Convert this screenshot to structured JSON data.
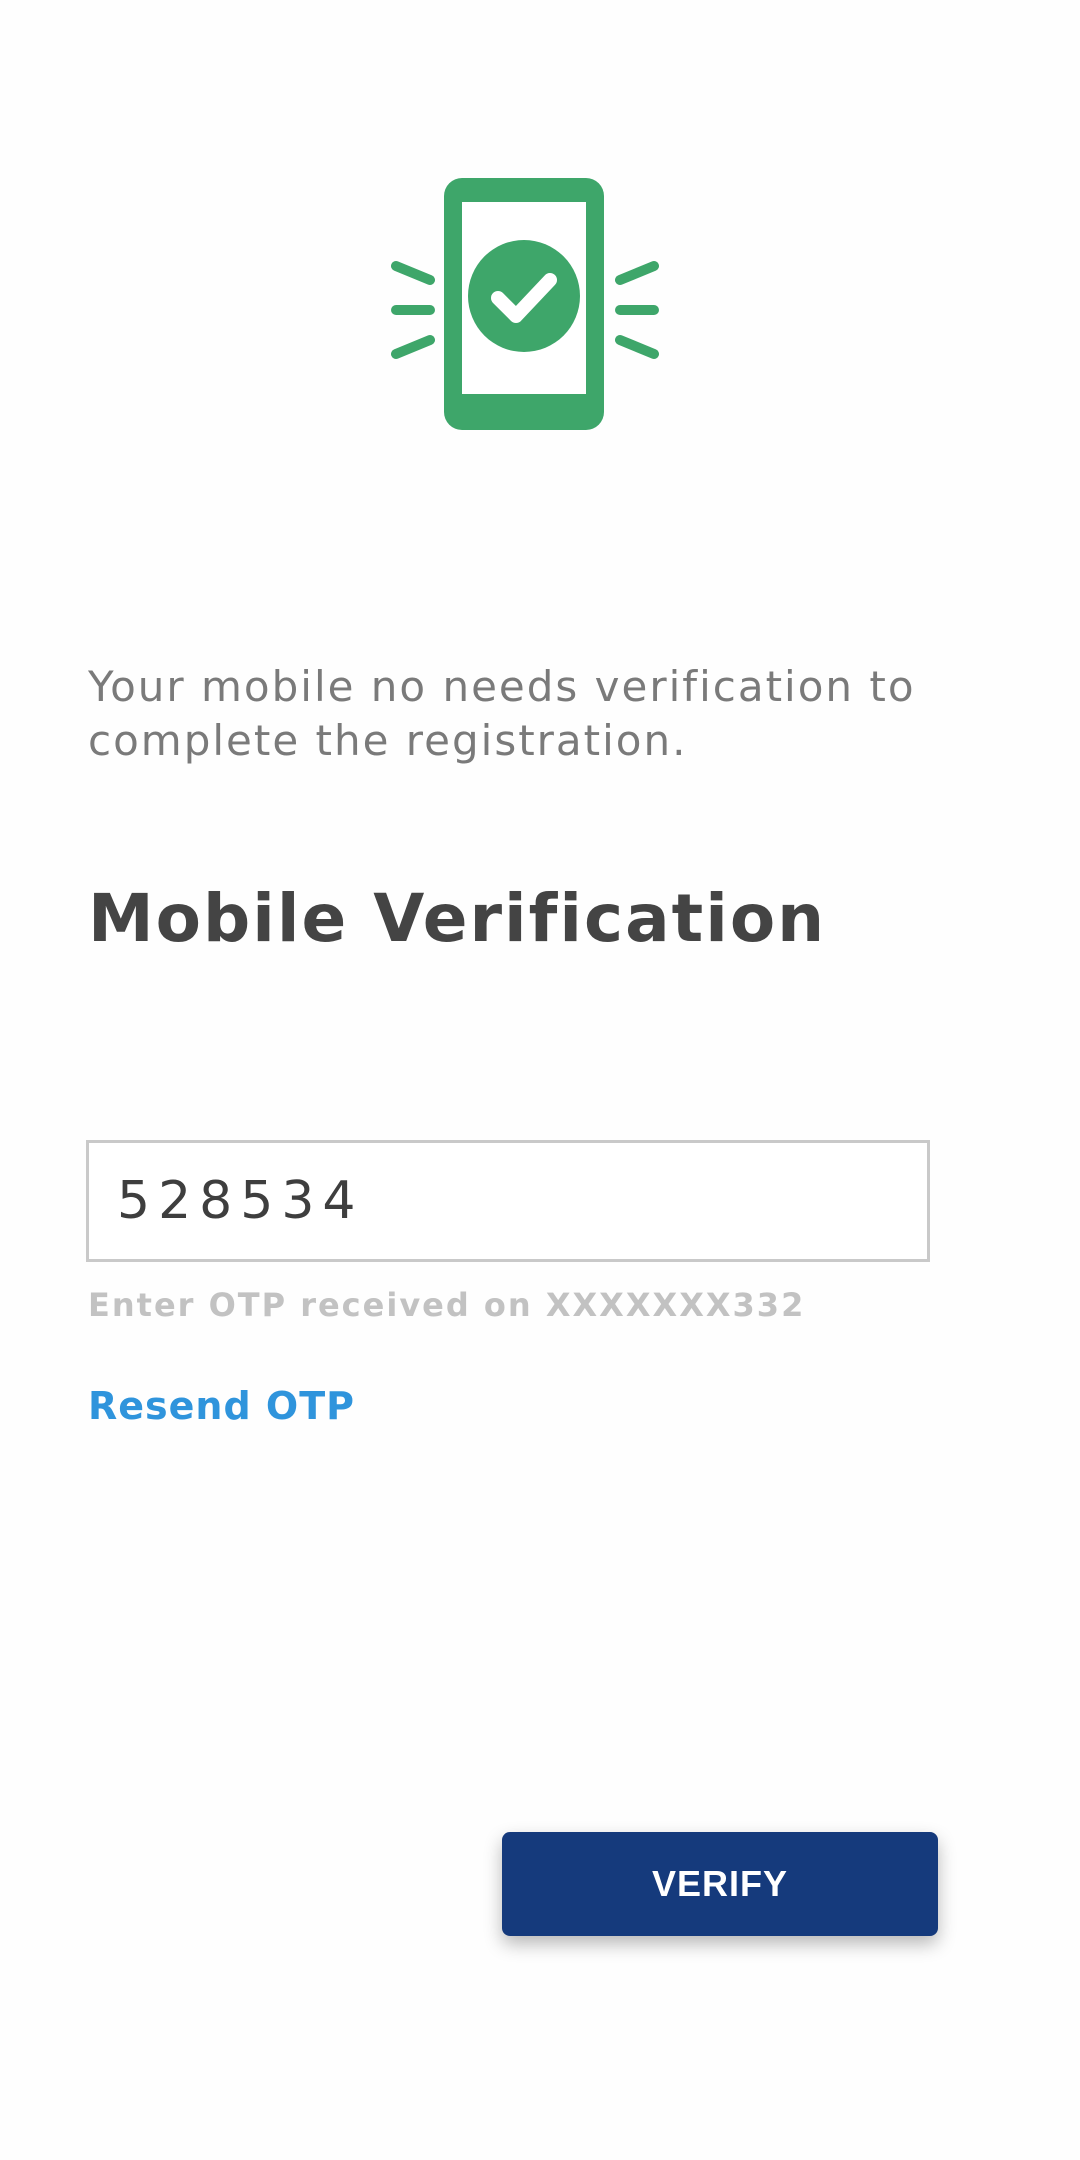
{
  "intro": {
    "message": "Your mobile no needs verification to complete the registration."
  },
  "title": "Mobile Verification",
  "otp": {
    "value": "528534",
    "helper": "Enter OTP received on XXXXXXX332"
  },
  "links": {
    "resend_label": "Resend OTP"
  },
  "actions": {
    "verify_label": "VERIFY"
  },
  "icons": {
    "hero": "phone-verified-icon"
  },
  "colors": {
    "accent_green": "#3ea66a",
    "link_blue": "#2f94dc",
    "primary_button": "#153a7c"
  }
}
